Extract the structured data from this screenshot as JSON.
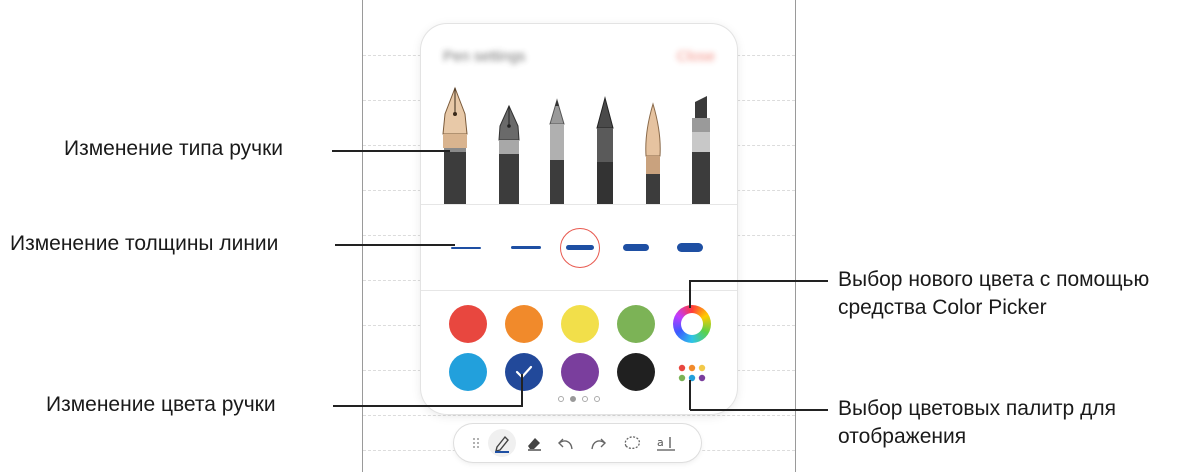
{
  "annotations": {
    "pen_type": "Изменение типа ручки",
    "line_thickness": "Изменение толщины линии",
    "pen_color": "Изменение цвета ручки",
    "color_picker": [
      "Выбор нового цвета с помощью",
      "средства Color Picker"
    ],
    "palettes": [
      "Выбор цветовых палитр для",
      "отображения"
    ]
  },
  "panel": {
    "title": "Pen settings",
    "close_label": "Close"
  },
  "pens": [
    {
      "name": "fountain-pen",
      "selected": true
    },
    {
      "name": "calligraphy-pen",
      "selected": false
    },
    {
      "name": "pencil",
      "selected": false
    },
    {
      "name": "marker",
      "selected": false
    },
    {
      "name": "brush",
      "selected": false
    },
    {
      "name": "highlighter",
      "selected": false
    }
  ],
  "thickness": {
    "levels": 5,
    "selected_index": 2
  },
  "colors": {
    "row1": [
      "#e8473f",
      "#f18a2b",
      "#f2df4a",
      "#7cb356",
      "color-wheel"
    ],
    "row2": [
      "#22a0dc",
      "#22499a",
      "#7a3e9d",
      "#202020",
      "palette-dots"
    ],
    "selected": "#22499a"
  },
  "pagination": {
    "pages": 4,
    "current": 1
  },
  "toolbar": [
    "drag-handle-icon",
    "pen-icon",
    "eraser-icon",
    "undo-icon",
    "redo-icon",
    "lasso-icon",
    "text-icon"
  ]
}
